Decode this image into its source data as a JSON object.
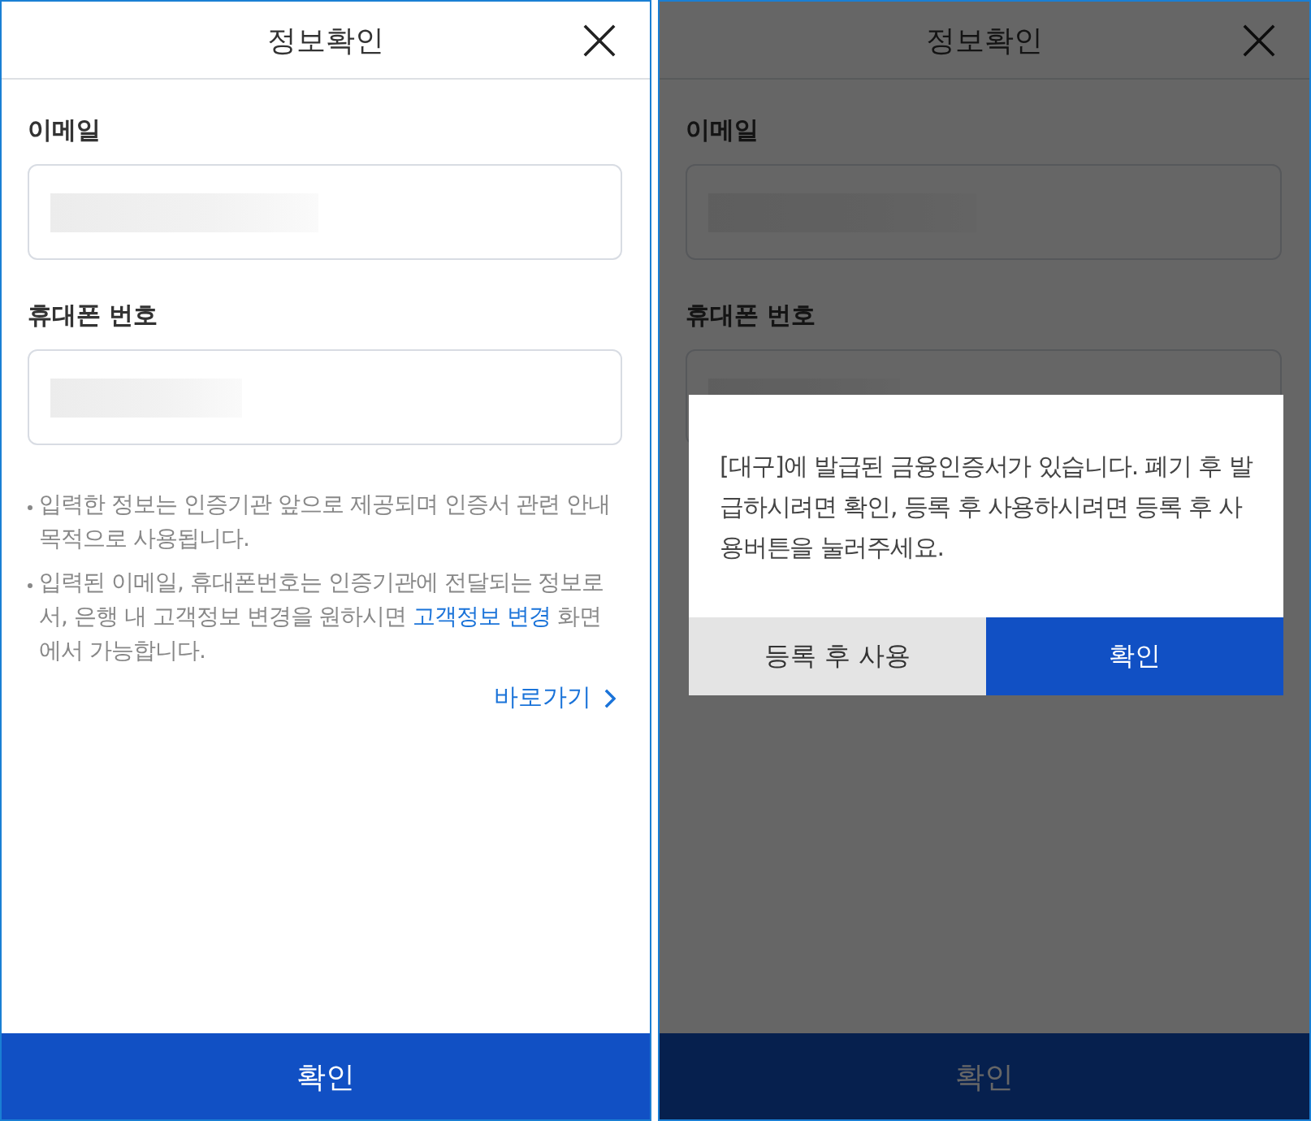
{
  "screens": [
    {
      "title": "정보확인",
      "dimmed": false,
      "fields": [
        {
          "label": "이메일"
        },
        {
          "label": "휴대폰 번호"
        }
      ],
      "notes": [
        {
          "text": "입력한 정보는 인증기관 앞으로 제공되며 인증서 관련 안내 목적으로 사용됩니다."
        },
        {
          "text": "입력된 이메일, 휴대폰번호는 인증기관에 전달되는 정보로서, 은행 내 고객정보 변경을 원하시면 ",
          "link": "고객정보 변경",
          "after": " 화면에서 가능합니다."
        }
      ],
      "shortcut_link": "바로가기",
      "confirm_button": "확인"
    },
    {
      "title": "정보확인",
      "dimmed": true,
      "fields": [
        {
          "label": "이메일"
        },
        {
          "label": "휴대폰 번호"
        }
      ],
      "confirm_button": "확인",
      "dialog": {
        "message": "[대구]에 발급된 금융인증서가 있습니다. 폐기 후 발급하시려면 확인, 등록 후 사용하시려면 등록 후 사용버튼을 눌러주세요.",
        "buttons": [
          {
            "label": "등록 후 사용",
            "kind": "secondary"
          },
          {
            "label": "확인",
            "kind": "primary"
          }
        ]
      }
    }
  ]
}
